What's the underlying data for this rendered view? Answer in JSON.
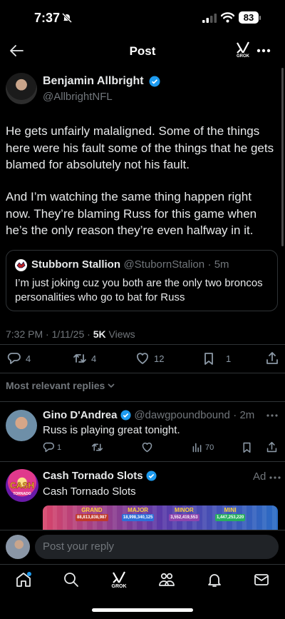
{
  "status_bar": {
    "time": "7:37",
    "battery": "83"
  },
  "header": {
    "title": "Post",
    "grok_label": "GROK"
  },
  "post": {
    "author_name": "Benjamin Allbright",
    "author_handle": "@AllbrightNFL",
    "paragraph1": "He gets unfairly malaligned. Some of the things here were his fault some of the things that he gets blamed for absolutely not his fault.",
    "paragraph2": "And I’m watching the same thing happen right now. They’re blaming Russ for this game when he’s the only reason they’re even halfway in it.",
    "meta_time": "7:32 PM · 1/11/25 · ",
    "meta_views": "5K",
    "meta_views_label": " Views",
    "quote": {
      "author_name": "Stubborn Stallion",
      "author_handle": "@StubornStalion",
      "time": "· 5m",
      "text": "I’m just joking cuz you both are the only two broncos personalities who go to bat for Russ"
    },
    "stats": {
      "replies": "4",
      "reposts": "4",
      "likes": "12",
      "bookmarks": "1"
    }
  },
  "replies_sort": {
    "label": "Most relevant replies"
  },
  "reply": {
    "author_name": "Gino D'Andrea",
    "author_handle": "@dawgpoundbound",
    "time": "· 2m",
    "text": "Russ is playing great tonight.",
    "stats": {
      "replies": "1",
      "views": "70"
    }
  },
  "ad": {
    "author_name": "Cash Tornado Slots",
    "ad_label": "Ad",
    "text": "Cash Tornado Slots",
    "logo_line1": "CASH",
    "logo_line2": "TORNADO",
    "jackpots": [
      {
        "name": "GRAND",
        "value": "88,813,838,987",
        "color": "#c0392b"
      },
      {
        "name": "MAJOR",
        "value": "18,998,340,125",
        "color": "#2e6fd8"
      },
      {
        "name": "MINOR",
        "value": "3,552,419,553",
        "color": "#8e44ad"
      },
      {
        "name": "MINI",
        "value": "1,447,253,220",
        "color": "#27ae60"
      }
    ]
  },
  "composer": {
    "placeholder": "Post your reply"
  },
  "bottom_nav": {
    "grok_label": "GROK"
  },
  "colors": {
    "accent": "#1d9bf0",
    "muted": "#71767b",
    "divider": "#2f3336"
  }
}
